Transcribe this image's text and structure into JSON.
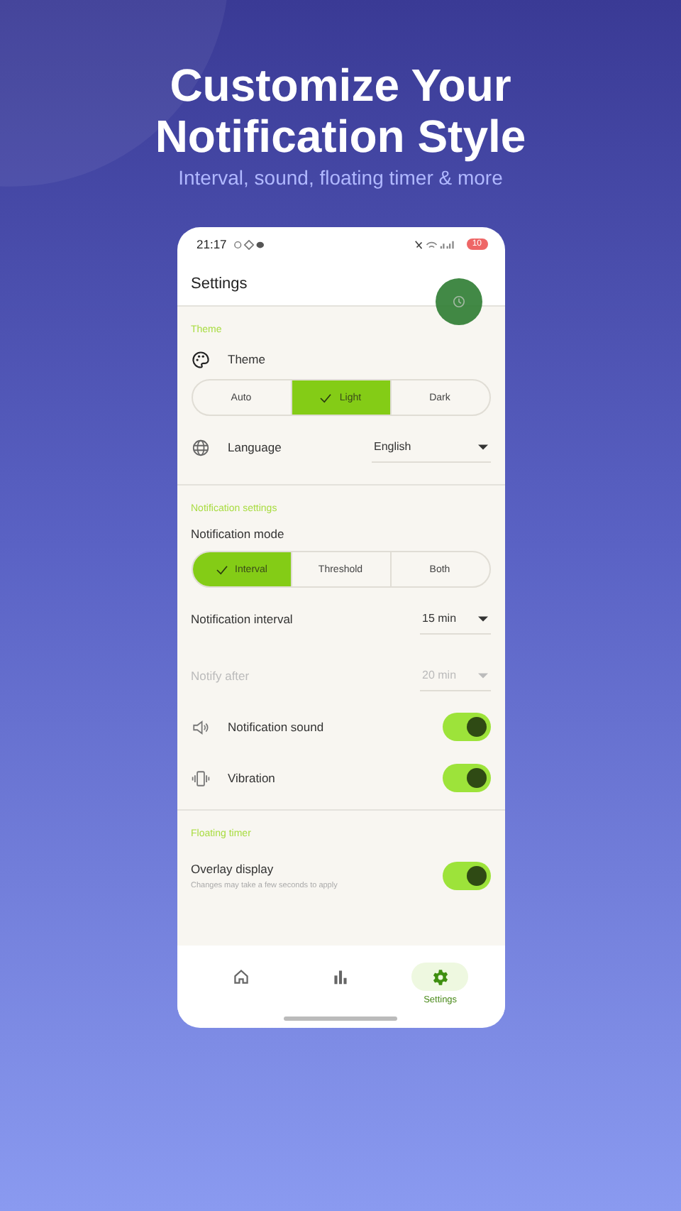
{
  "headline": "Customize Your Notification Style",
  "subtitle": "Interval, sound, floating timer & more",
  "status_bar": {
    "time": "21:17",
    "battery": "10"
  },
  "app_bar": {
    "title": "Settings"
  },
  "theme_section": {
    "title": "Theme",
    "label": "Theme",
    "options": [
      {
        "label": "Auto",
        "selected": false
      },
      {
        "label": "Light",
        "selected": true
      },
      {
        "label": "Dark",
        "selected": false
      }
    ],
    "language": {
      "label": "Language",
      "value": "English"
    }
  },
  "notification_section": {
    "title": "Notification settings",
    "mode_label": "Notification mode",
    "modes": [
      {
        "label": "Interval",
        "selected": true
      },
      {
        "label": "Threshold",
        "selected": false
      },
      {
        "label": "Both",
        "selected": false
      }
    ],
    "interval": {
      "label": "Notification interval",
      "value": "15 min",
      "disabled": false
    },
    "notify_after": {
      "label": "Notify after",
      "value": "20 min",
      "disabled": true
    },
    "sound": {
      "label": "Notification sound",
      "on": true
    },
    "vibration": {
      "label": "Vibration",
      "on": true
    }
  },
  "floating_section": {
    "title": "Floating timer",
    "overlay": {
      "label": "Overlay display",
      "hint": "Changes may take a few seconds to apply",
      "on": true
    }
  },
  "bottom_nav": [
    {
      "kind": "home",
      "selected": false
    },
    {
      "kind": "stats",
      "selected": false
    },
    {
      "kind": "settings",
      "label": "Settings",
      "selected": true
    }
  ]
}
